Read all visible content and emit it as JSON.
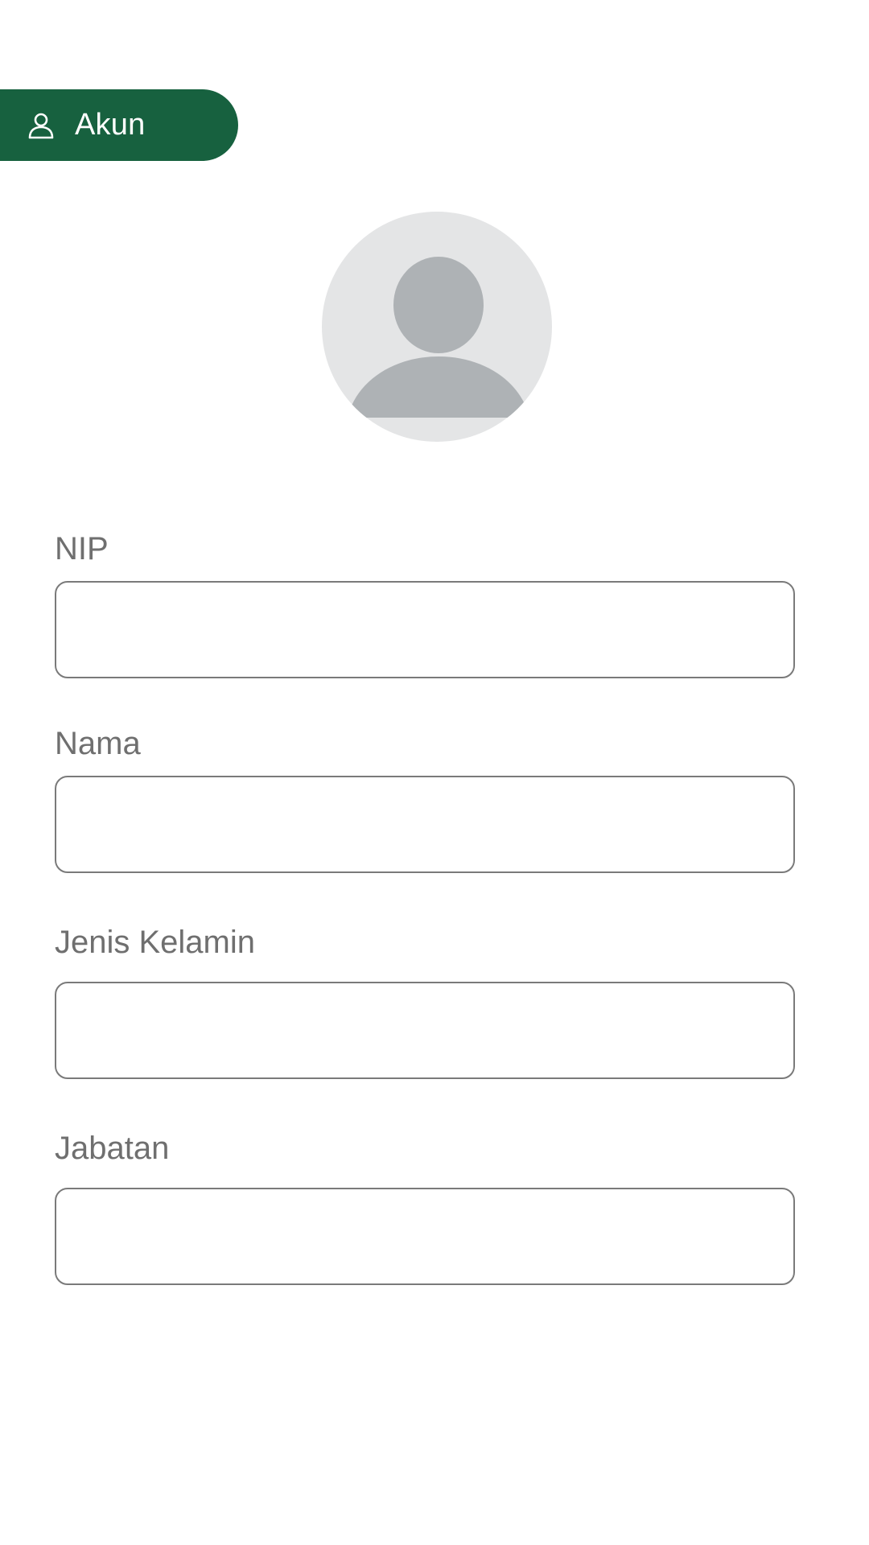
{
  "header": {
    "account_tab_label": "Akun",
    "account_icon": "person-outline-icon",
    "accent_color": "#17613f"
  },
  "profile": {
    "avatar_icon": "default-avatar-icon"
  },
  "form": {
    "nip_label": "NIP",
    "nip_value": "",
    "nama_label": "Nama",
    "nama_value": "",
    "jenis_kelamin_label": "Jenis Kelamin",
    "jenis_kelamin_value": "",
    "jabatan_label": "Jabatan",
    "jabatan_value": ""
  }
}
